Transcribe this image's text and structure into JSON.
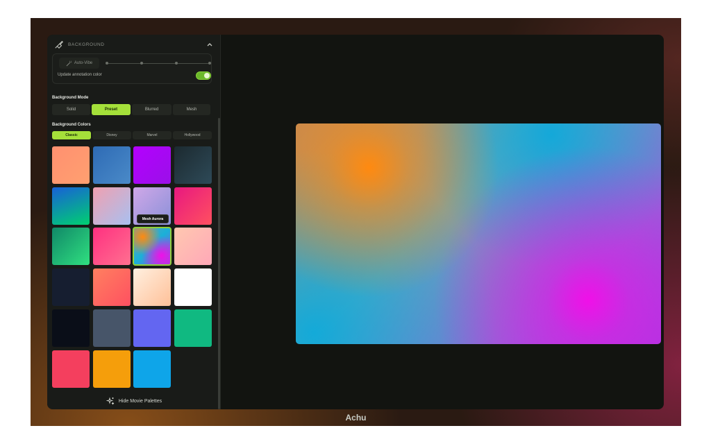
{
  "app": {
    "name": "Achu"
  },
  "background_section": {
    "title": "BACKGROUND",
    "auto_vibe_label": "Auto-Vibe",
    "update_annotation_label": "Update annotation color",
    "update_annotation_enabled": true
  },
  "mode": {
    "label": "Background Mode",
    "options": [
      "Solid",
      "Preset",
      "Blurred",
      "Mesh"
    ],
    "selected": "Preset"
  },
  "colors": {
    "label": "Background Colors",
    "tabs": [
      "Classic",
      "Disney",
      "Marvel",
      "Hollywood"
    ],
    "selected_tab": "Classic",
    "hovered_tooltip": "Mesh Aurora",
    "selected_swatch": "Mesh Aurora"
  },
  "hide_palettes_label": "Hide Movie Palettes",
  "accent_color": "#a5e03a"
}
